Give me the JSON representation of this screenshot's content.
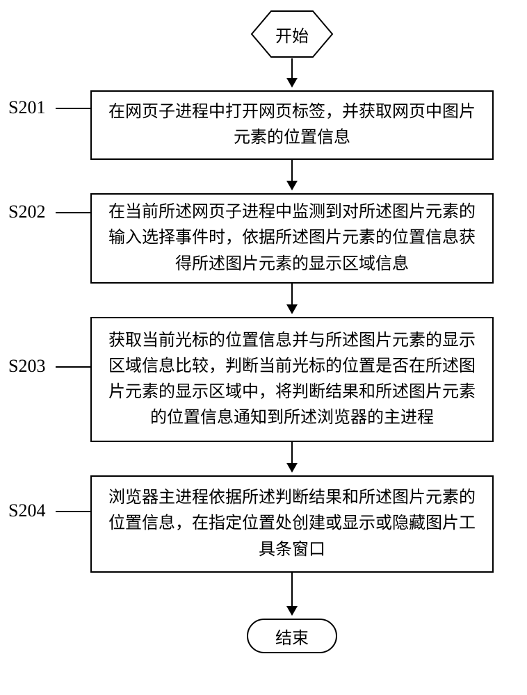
{
  "start": "开始",
  "end": "结束",
  "steps": [
    {
      "id": "S201",
      "text": "在网页子进程中打开网页标签，并获取网页中图片元素的位置信息"
    },
    {
      "id": "S202",
      "text": "在当前所述网页子进程中监测到对所述图片元素的输入选择事件时，依据所述图片元素的位置信息获得所述图片元素的显示区域信息"
    },
    {
      "id": "S203",
      "text": "获取当前光标的位置信息并与所述图片元素的显示区域信息比较，判断当前光标的位置是否在所述图片元素的显示区域中，将判断结果和所述图片元素的位置信息通知到所述浏览器的主进程"
    },
    {
      "id": "S204",
      "text": "浏览器主进程依据所述判断结果和所述图片元素的位置信息，在指定位置处创建或显示或隐藏图片工具条窗口"
    }
  ]
}
